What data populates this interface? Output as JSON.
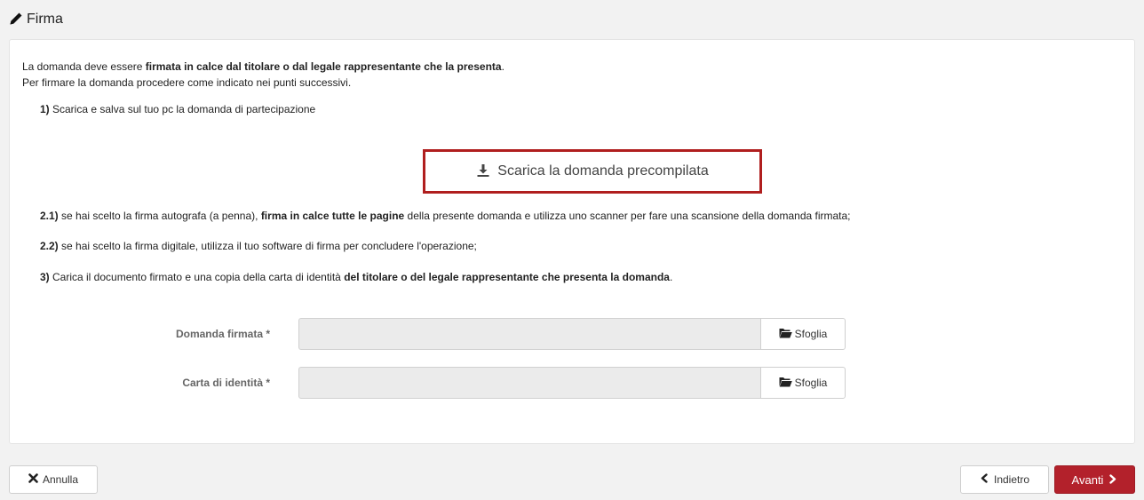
{
  "header": {
    "title": "Firma",
    "icon": "pencil-icon"
  },
  "intro": {
    "line1_pre": "La domanda deve essere ",
    "line1_bold": "firmata in calce dal titolare o dal legale rappresentante che la presenta",
    "line1_post": ".",
    "line2": "Per firmare la domanda procedere come indicato nei punti successivi."
  },
  "steps": {
    "s1_num": "1)",
    "s1_text": " Scarica e salva sul tuo pc la domanda di partecipazione",
    "s21_num": "2.1)",
    "s21_pre": " se hai scelto la firma autografa (a penna), ",
    "s21_bold": "firma in calce tutte le pagine",
    "s21_post": " della presente domanda e utilizza uno scanner per fare una scansione della domanda firmata;",
    "s22_num": "2.2)",
    "s22_text": " se hai scelto la firma digitale, utilizza il tuo software di firma per concludere l'operazione;",
    "s3_num": "3)",
    "s3_pre": " Carica il documento firmato e una copia della carta di identità ",
    "s3_bold": "del titolare o del legale rappresentante che presenta la domanda",
    "s3_post": "."
  },
  "download": {
    "label": "Scarica la domanda precompilata",
    "icon": "download-icon",
    "highlight_color": "#b01e1e"
  },
  "form": {
    "signed_label": "Domanda firmata *",
    "signed_value": "",
    "id_label": "Carta di identità *",
    "id_value": "",
    "browse_label": "Sfoglia",
    "browse_icon": "folder-open-icon"
  },
  "footer": {
    "cancel_label": "Annulla",
    "cancel_icon": "close-icon",
    "back_label": "Indietro",
    "back_icon": "chevron-left-icon",
    "next_label": "Avanti",
    "next_icon": "chevron-right-icon",
    "next_color": "#b3212b"
  }
}
